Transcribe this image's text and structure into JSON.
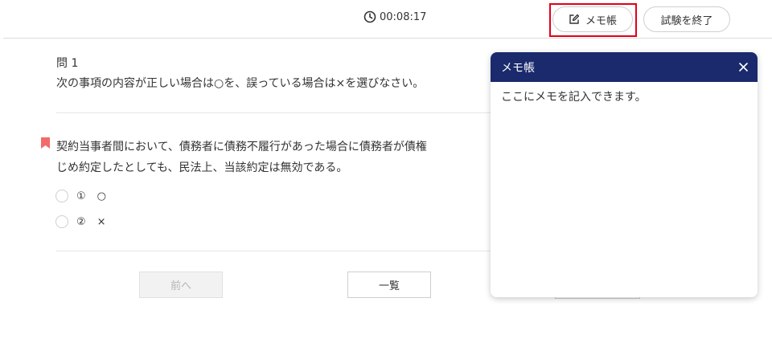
{
  "header": {
    "timer": "00:08:17",
    "memo_button_label": "メモ帳",
    "end_button_label": "試験を終了"
  },
  "question": {
    "number_label": "問 1",
    "instruction": "次の事項の内容が正しい場合は○を、誤っている場合は×を選びなさい。",
    "statement_line1": "契約当事者間において、債務者に債務不履行があった場合に債務者が債権",
    "statement_line2": "じめ約定したとしても、民法上、当該約定は無効である。",
    "options": [
      {
        "num": "①",
        "label": "○"
      },
      {
        "num": "②",
        "label": "×"
      }
    ]
  },
  "nav": {
    "prev_label": "前へ",
    "list_label": "一覧"
  },
  "memo": {
    "title": "メモ帳",
    "placeholder": "ここにメモを記入できます。"
  },
  "colors": {
    "memo_header_bg": "#1a2a6c",
    "highlight_outline": "#e0001a",
    "bookmark": "#f26b6b"
  }
}
